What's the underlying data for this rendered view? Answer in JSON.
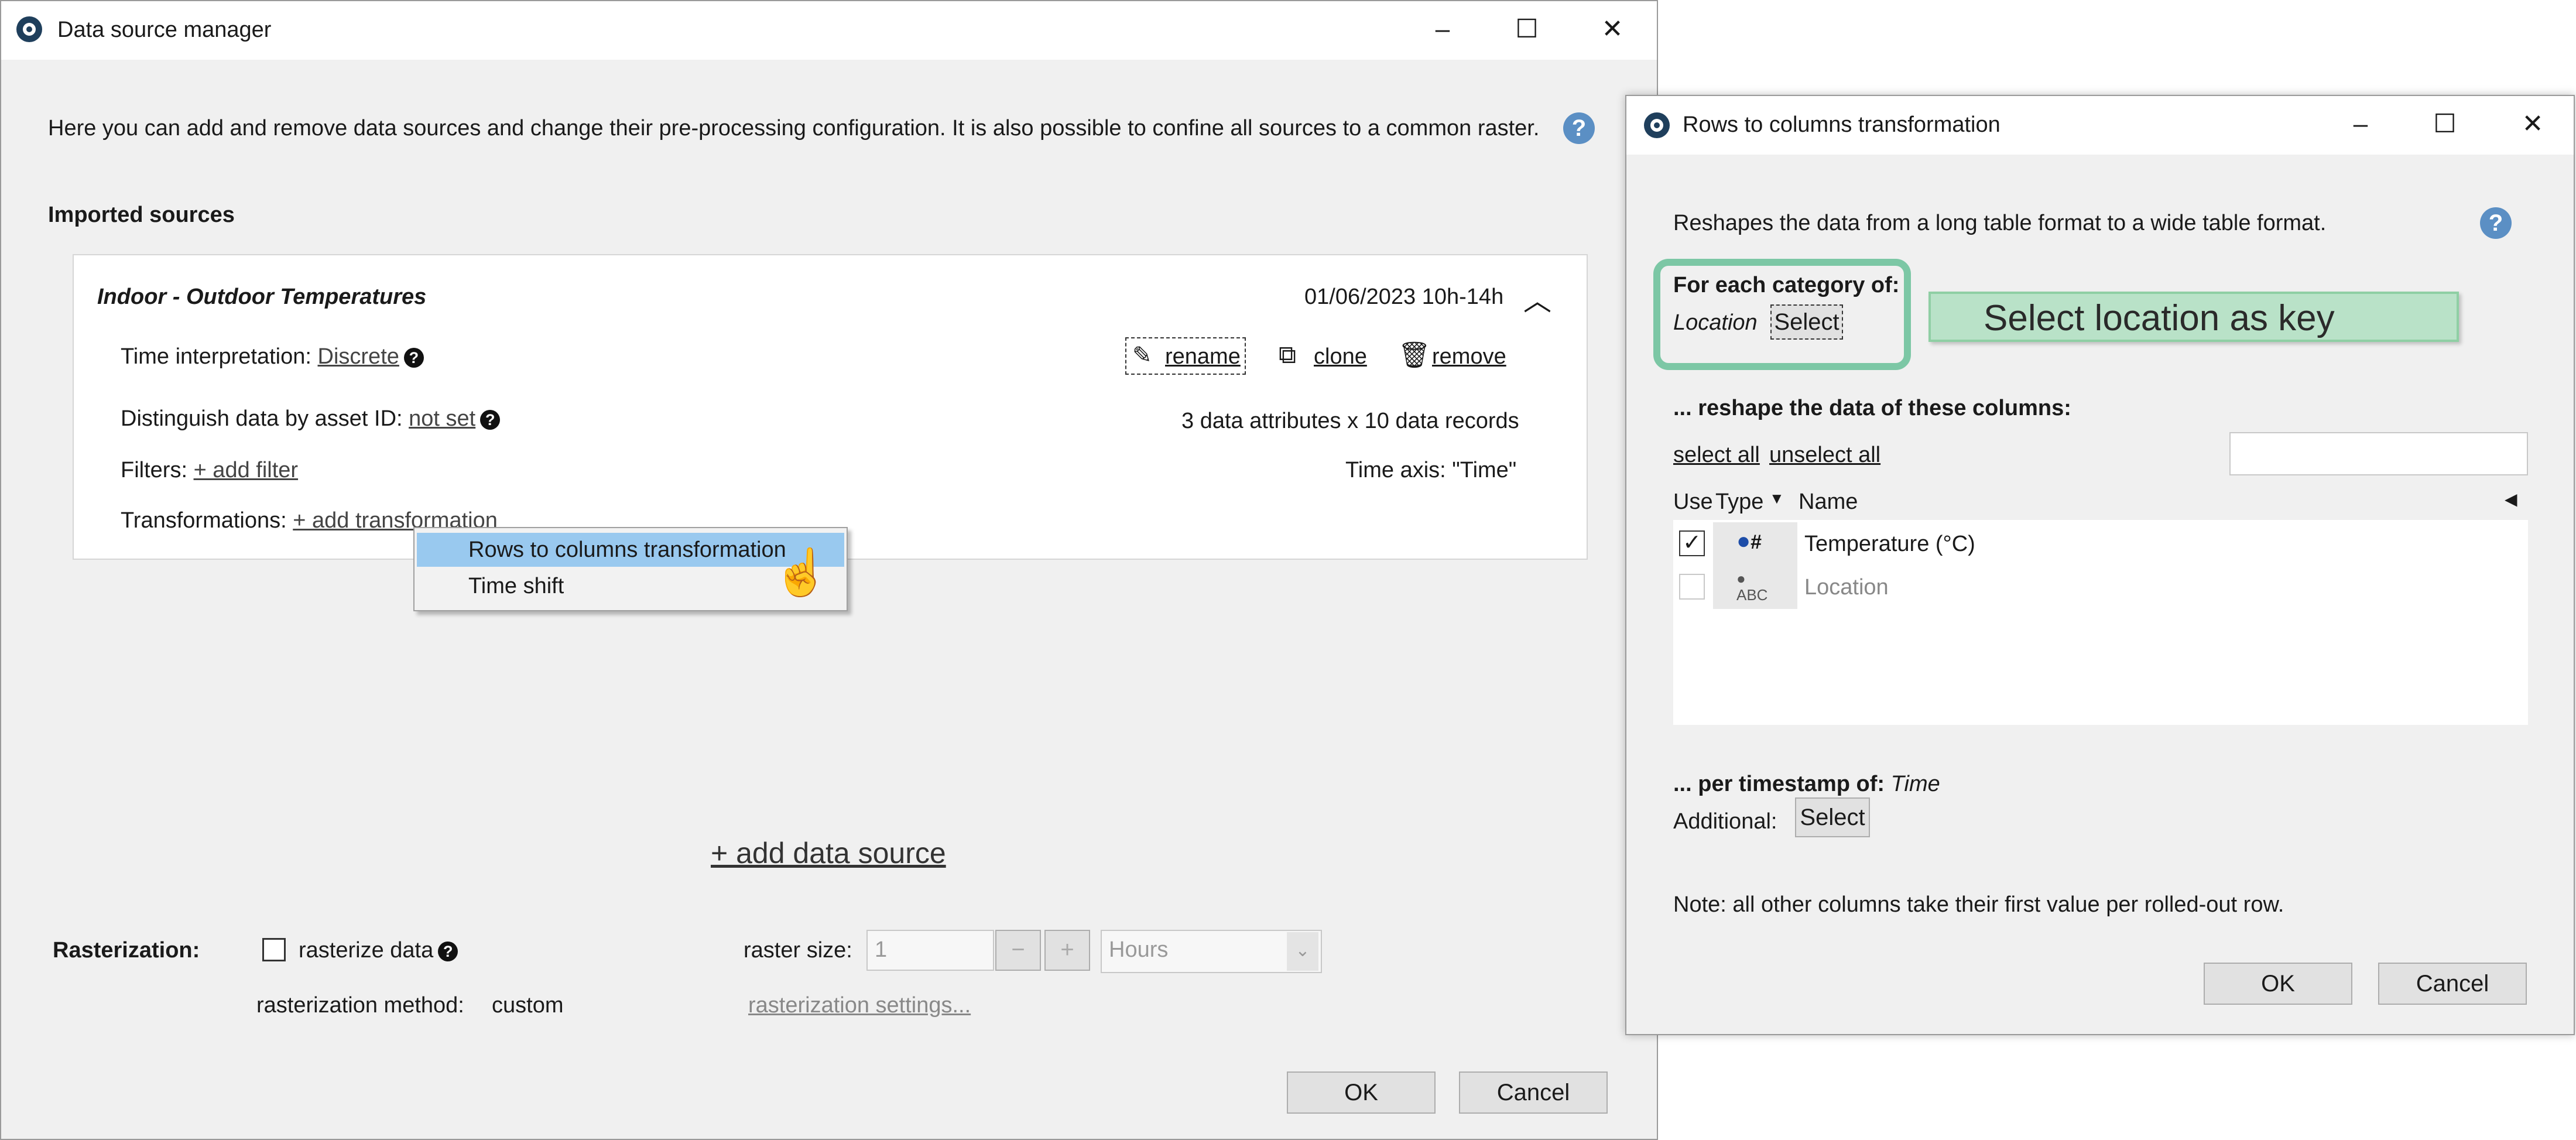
{
  "main_window": {
    "title": "Data source manager",
    "description": "Here you can add and remove data sources and change their pre-processing configuration. It is also possible to confine all sources to a common raster.",
    "imported_sources_heading": "Imported sources",
    "source": {
      "name": "Indoor - Outdoor Temperatures",
      "date": "01/06/2023 10h-14h",
      "time_interpretation_label": "Time interpretation:",
      "time_interpretation_value": "Discrete",
      "rename": "rename",
      "clone": "clone",
      "remove": "remove",
      "asset_id_label": "Distinguish data by asset ID:",
      "asset_id_value": "not set",
      "records_info": "3 data attributes x 10 data records",
      "filters_label": "Filters:",
      "add_filter": "+ add filter",
      "time_axis": "Time axis: \"Time\"",
      "transformations_label": "Transformations:",
      "add_transformation": "+ add transformation"
    },
    "context_menu": [
      "Rows to columns transformation",
      "Time shift"
    ],
    "add_data_source": "+ add data source",
    "rasterization_label": "Rasterization:",
    "rasterize_data": "rasterize data",
    "raster_size_label": "raster size:",
    "raster_size_value": "1",
    "raster_unit": "Hours",
    "rasterization_method_label": "rasterization method:",
    "rasterization_method_value": "custom",
    "rasterization_settings": "rasterization settings...",
    "ok": "OK",
    "cancel": "Cancel"
  },
  "dialog": {
    "title": "Rows to columns transformation",
    "description": "Reshapes the data from a long table format to a wide table format.",
    "category_heading": "For each category of:",
    "category_value": "Location",
    "select": "Select",
    "annotation": "Select location as key",
    "reshape_heading": "... reshape the data of these columns:",
    "select_all": "select all",
    "unselect_all": "unselect all",
    "columns": {
      "use": "Use",
      "type": "Type",
      "name": "Name"
    },
    "rows": [
      {
        "checked": true,
        "name": "Temperature (°C)",
        "enabled": true,
        "type_icon": "numeric-type-icon"
      },
      {
        "checked": false,
        "name": "Location",
        "enabled": false,
        "type_icon": "text-type-icon"
      }
    ],
    "per_timestamp_label": "... per timestamp of:",
    "per_timestamp_value": "Time",
    "additional_label": "Additional:",
    "note": "Note: all other columns take their first value per rolled-out row.",
    "ok": "OK",
    "cancel": "Cancel"
  },
  "colors": {
    "accent_highlight": "#99c9ef",
    "annotation_green": "#7cc7a5",
    "help_blue": "#5b8fc4"
  }
}
